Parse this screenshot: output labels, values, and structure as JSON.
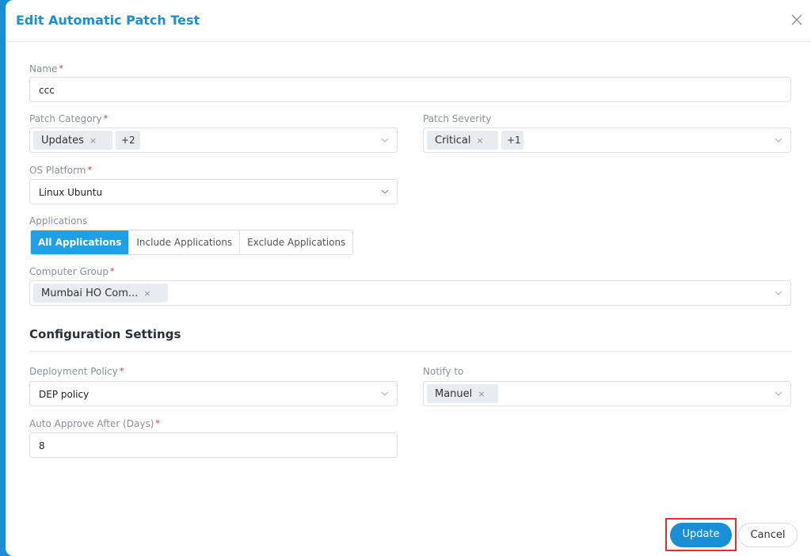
{
  "dialog": {
    "title": "Edit Automatic Patch Test"
  },
  "form": {
    "name": {
      "label": "Name",
      "value": "ccc"
    },
    "patch_category": {
      "label": "Patch Category",
      "tag": "Updates",
      "more": "+2"
    },
    "patch_severity": {
      "label": "Patch Severity",
      "tag": "Critical",
      "more": "+1"
    },
    "os_platform": {
      "label": "OS Platform",
      "value": "Linux Ubuntu"
    },
    "applications": {
      "label": "Applications",
      "options": [
        "All Applications",
        "Include Applications",
        "Exclude Applications"
      ],
      "selected": "All Applications"
    },
    "computer_group": {
      "label": "Computer Group",
      "tag": "Mumbai HO Com..."
    }
  },
  "configuration": {
    "heading": "Configuration Settings",
    "deployment_policy": {
      "label": "Deployment Policy",
      "value": "DEP policy"
    },
    "notify_to": {
      "label": "Notify to",
      "tag": "Manuel"
    },
    "auto_approve": {
      "label": "Auto Approve After (Days)",
      "value": "8"
    }
  },
  "footer": {
    "update_label": "Update",
    "cancel_label": "Cancel"
  },
  "icons": {
    "required": "*",
    "remove": "×"
  },
  "colors": {
    "accent": "#1a8fd6",
    "required": "#e03131",
    "highlight": "#e03131"
  }
}
